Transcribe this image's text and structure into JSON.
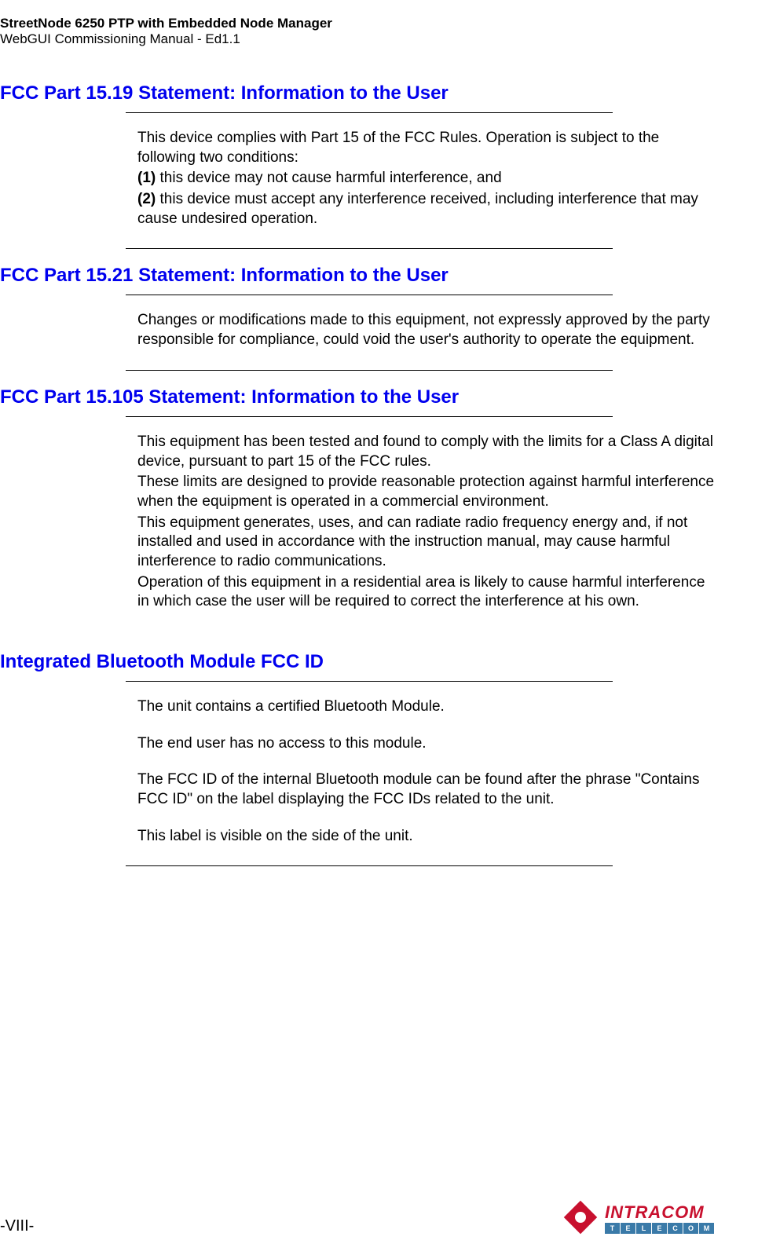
{
  "header": {
    "title": "StreetNode 6250 PTP with Embedded Node Manager",
    "subtitle": "WebGUI Commissioning Manual - Ed1.1"
  },
  "sections": [
    {
      "heading": "FCC Part 15.19 Statement: Information to the User",
      "paragraphs": [
        {
          "text": "This device complies with Part 15 of the FCC Rules. Operation is subject to the following two conditions:"
        },
        {
          "bold": "(1)",
          "text": " this device may not cause harmful interference, and"
        },
        {
          "bold": "(2)",
          "text": " this device must accept any interference received, including interference that may cause undesired operation."
        }
      ],
      "closingDivider": true
    },
    {
      "heading": "FCC Part 15.21 Statement: Information to the User",
      "paragraphs": [
        {
          "text": "Changes or modifications made to this equipment, not expressly approved by the party responsible for compliance, could void the user's authority to operate the equipment."
        }
      ],
      "closingDivider": true
    },
    {
      "heading": "FCC Part 15.105 Statement: Information to the User",
      "paragraphs": [
        {
          "text": "This equipment has been tested and found to comply with the limits for a Class A digital device, pursuant to part 15 of the FCC rules."
        },
        {
          "text": "These limits are designed to provide reasonable protection against harmful interference when the equipment is operated in a commercial environment."
        },
        {
          "text": "This equipment generates, uses, and can radiate radio frequency energy and, if not installed and used in accordance with the instruction manual, may cause harmful interference to radio communications."
        },
        {
          "text": "Operation of this equipment in a residential area is likely to cause harmful interference in which case the user will be required to correct the interference at his own."
        }
      ],
      "closingDivider": false
    },
    {
      "heading": "Integrated Bluetooth Module FCC ID",
      "paragraphs": [
        {
          "text": "The unit contains a certified Bluetooth Module.",
          "gap": true
        },
        {
          "text": "The end user has no access to this module.",
          "gap": true
        },
        {
          "text": "The FCC ID of the internal Bluetooth module can be found after the phrase \"Contains FCC ID\"   on the label displaying the FCC IDs related to the unit.",
          "gap": true
        },
        {
          "text": "This label is visible on the side of the unit."
        }
      ],
      "closingDivider": true
    }
  ],
  "footer": {
    "pageNumber": "-VIII-",
    "logo": {
      "name": "INTRACOM",
      "subtitle": "TELECOM"
    }
  }
}
